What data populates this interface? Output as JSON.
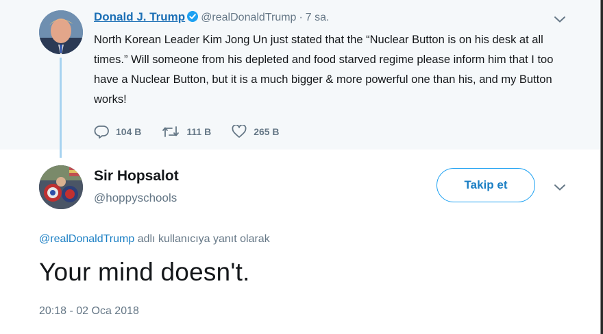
{
  "parent_tweet": {
    "name": "Donald J. Trump",
    "handle": "@realDonaldTrump",
    "separator": "·",
    "time": "7 sa.",
    "text": "North Korean Leader Kim Jong Un just stated that the “Nuclear Button is on his desk at all times.” Will someone from his depleted and food starved regime please inform him that I too have a Nuclear Button, but it is a much bigger & more powerful one than his, and my Button works!",
    "replies": "104 B",
    "retweets": "111 B",
    "likes": "265 B"
  },
  "reply_tweet": {
    "name": "Sir Hopsalot",
    "handle": "@hoppyschools",
    "follow_label": "Takip et",
    "reply_to_mention": "@realDonaldTrump",
    "reply_to_suffix": " adlı kullanıcıya yanıt olarak",
    "text": "Your mind doesn't.",
    "timestamp": "20:18 - 02 Oca 2018"
  },
  "icons": {
    "verified": "verified-badge-icon",
    "caret": "chevron-down-icon",
    "reply": "reply-icon",
    "retweet": "retweet-icon",
    "like": "heart-icon"
  },
  "colors": {
    "accent": "#1da1f2",
    "link": "#1b7fc4",
    "muted": "#657786",
    "parent_bg": "#f5f8fa",
    "thread_line": "#a7d3f0"
  }
}
